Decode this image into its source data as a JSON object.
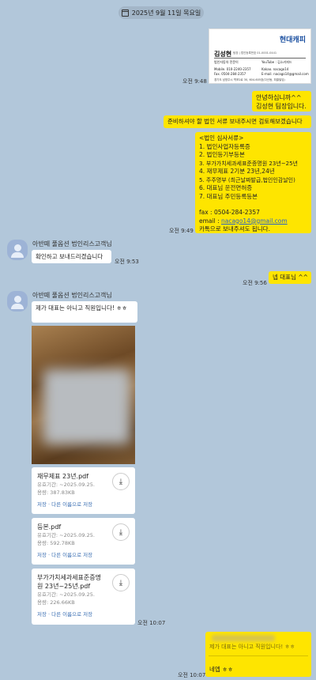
{
  "date_divider": "2025년 9월 11일 목요일",
  "messages": {
    "m1": {
      "time": "오전 9:48"
    },
    "bizcard": {
      "logo": "현대캐피",
      "name": "김성현",
      "title": "팀장 | 법인등록번호 01-0001-0441",
      "company": "법인자동차 전문이",
      "youtube": "YouTube : 김소카피드",
      "mobile": "Mobile. 010-2240-2357",
      "kakao": "Kakao. nacago14",
      "fax": "Fax. 0504-284-2357",
      "email": "E-mail. nacago14@gmail.com",
      "address": "경기도 남양주시 역포2로 30, 604-605호(다산동, 피클빌딩)"
    },
    "m2": {
      "lines": [
        "안녕하십니까^^",
        "김성현 팀장입니다."
      ]
    },
    "m3": {
      "text": "준비하셔야 할 법인 서류 보내주시면 검토해보겠습니다"
    },
    "m4": {
      "lines": [
        "<법인 심사서류>",
        "1. 법인사업자등록증",
        "2. 법인등기부등본",
        "3. 부가가치세과세표준증명원 23년~25년",
        "4. 재무제표 2기분 23년,24년",
        "5. 주주명부 (최근날짜발급,법인인감날인)",
        "6. 대표님 운전면허증",
        "7. 대표님 주민등록등본"
      ],
      "fax": "fax : 0504-284-2357",
      "email_label": "email : ",
      "email": "nacago14@gmail.com",
      "closing": "카톡으로 보내주셔도 됩니다.",
      "time": "오전 9:49"
    },
    "other1": {
      "sender": "아반떼 풀옵션 법인리스고객님",
      "text": "확인하고 보내드리겠습니다",
      "time": "오전 9:53"
    },
    "m5": {
      "text": "넵 대표님 ^^",
      "time": "오전 9:56"
    },
    "other2": {
      "sender": "아반떼 풀옵션 법인리스고객님",
      "text": "제가 대표는 아니고 직원입니다! ㅎㅎ",
      "files": [
        {
          "name": "재무제표 23년.pdf",
          "expiry": "유효기간: ~2025.09.25.",
          "size": "용량: 387.83KB",
          "actions": "저장 · 다른 이름으로 저장"
        },
        {
          "name": "등본.pdf",
          "expiry": "유효기간: ~2025.09.25.",
          "size": "용량: 592.78KB",
          "actions": "저장 · 다른 이름으로 저장"
        },
        {
          "name_l1": "부가가치세과세표준증명",
          "name_l2": "원 23년~25년.pdf",
          "expiry": "유효기간: ~2025.09.25.",
          "size": "용량: 226.66KB",
          "actions": "저장 · 다른 이름으로 저장"
        }
      ],
      "time": "오전 10:07"
    },
    "m6": {
      "quote": "제가 대표는 아니고 직원입니다! ㅎㅎ",
      "text": "네엡 ㅎㅎ",
      "time": "오전 10:07"
    }
  }
}
